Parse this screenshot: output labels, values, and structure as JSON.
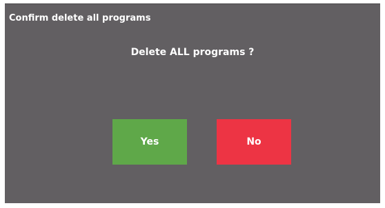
{
  "dialog": {
    "title": "Confirm delete all programs",
    "message": "Delete ALL programs ?",
    "yes_label": "Yes",
    "no_label": "No"
  },
  "colors": {
    "dialog_background": "#625f62",
    "yes_button": "#5fa849",
    "no_button": "#ed3444",
    "text": "#ffffff"
  }
}
